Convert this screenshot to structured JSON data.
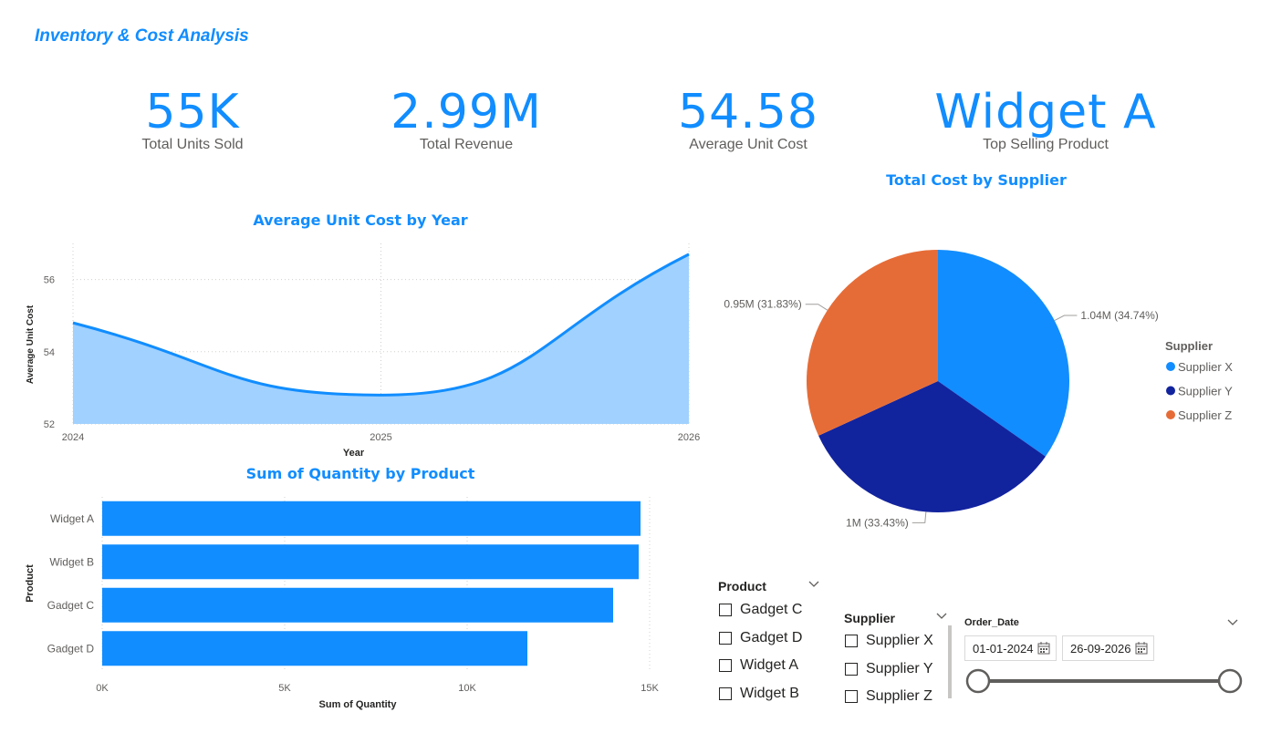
{
  "title": "Inventory & Cost Analysis",
  "kpis": [
    {
      "value": "55K",
      "label": "Total Units Sold"
    },
    {
      "value": "2.99M",
      "label": "Total Revenue"
    },
    {
      "value": "54.58",
      "label": "Average Unit Cost"
    },
    {
      "value": "Widget A",
      "label": "Top Selling Product"
    }
  ],
  "chart_titles": {
    "line": "Average Unit Cost by Year",
    "bar": "Sum of Quantity by Product",
    "pie": "Total Cost by Supplier"
  },
  "chart_data": [
    {
      "type": "area",
      "title": "Average Unit Cost by Year",
      "xlabel": "Year",
      "ylabel": "Average Unit Cost",
      "x": [
        2024,
        2025,
        2026
      ],
      "x_tick_labels": [
        "2024",
        "2025",
        "2026"
      ],
      "y_ticks": [
        52,
        54,
        56
      ],
      "ylim": [
        52,
        57
      ],
      "series": [
        {
          "values": [
            54.8,
            52.8,
            56.7
          ]
        }
      ],
      "color": "#118dff",
      "fill_color": "#a0d1ff",
      "grid": true
    },
    {
      "type": "bar",
      "orientation": "horizontal",
      "title": "Sum of Quantity by Product",
      "xlabel": "Sum of Quantity",
      "ylabel": "Product",
      "categories": [
        "Widget A",
        "Widget B",
        "Gadget C",
        "Gadget D"
      ],
      "values": [
        14750,
        14700,
        14000,
        11650
      ],
      "x_ticks": [
        0,
        5000,
        10000,
        15000
      ],
      "x_tick_labels": [
        "0K",
        "5K",
        "10K",
        "15K"
      ],
      "xlim": [
        0,
        15000
      ],
      "color": "#118dff",
      "grid": true
    },
    {
      "type": "pie",
      "title": "Total Cost by Supplier",
      "legend_title": "Supplier",
      "legend_position": "right",
      "slices": [
        {
          "name": "Supplier X",
          "value": 1.04,
          "percent": 34.74,
          "label": "1.04M (34.74%)",
          "color": "#118dff"
        },
        {
          "name": "Supplier Y",
          "value": 1.0,
          "percent": 33.43,
          "label": "1M (33.43%)",
          "color": "#12239e"
        },
        {
          "name": "Supplier Z",
          "value": 0.95,
          "percent": 31.83,
          "label": "0.95M (31.83%)",
          "color": "#e66c37"
        }
      ]
    }
  ],
  "slicers": {
    "product": {
      "header": "Product",
      "items": [
        "Gadget C",
        "Gadget D",
        "Widget A",
        "Widget B"
      ]
    },
    "supplier": {
      "header": "Supplier",
      "items": [
        "Supplier X",
        "Supplier Y",
        "Supplier Z"
      ]
    },
    "order_date": {
      "header": "Order_Date",
      "start": "01-01-2024",
      "end": "26-09-2026",
      "range_fraction": [
        0,
        1
      ]
    }
  },
  "icons": {
    "chevron": "chevron-down-icon",
    "calendar": "calendar-icon"
  }
}
